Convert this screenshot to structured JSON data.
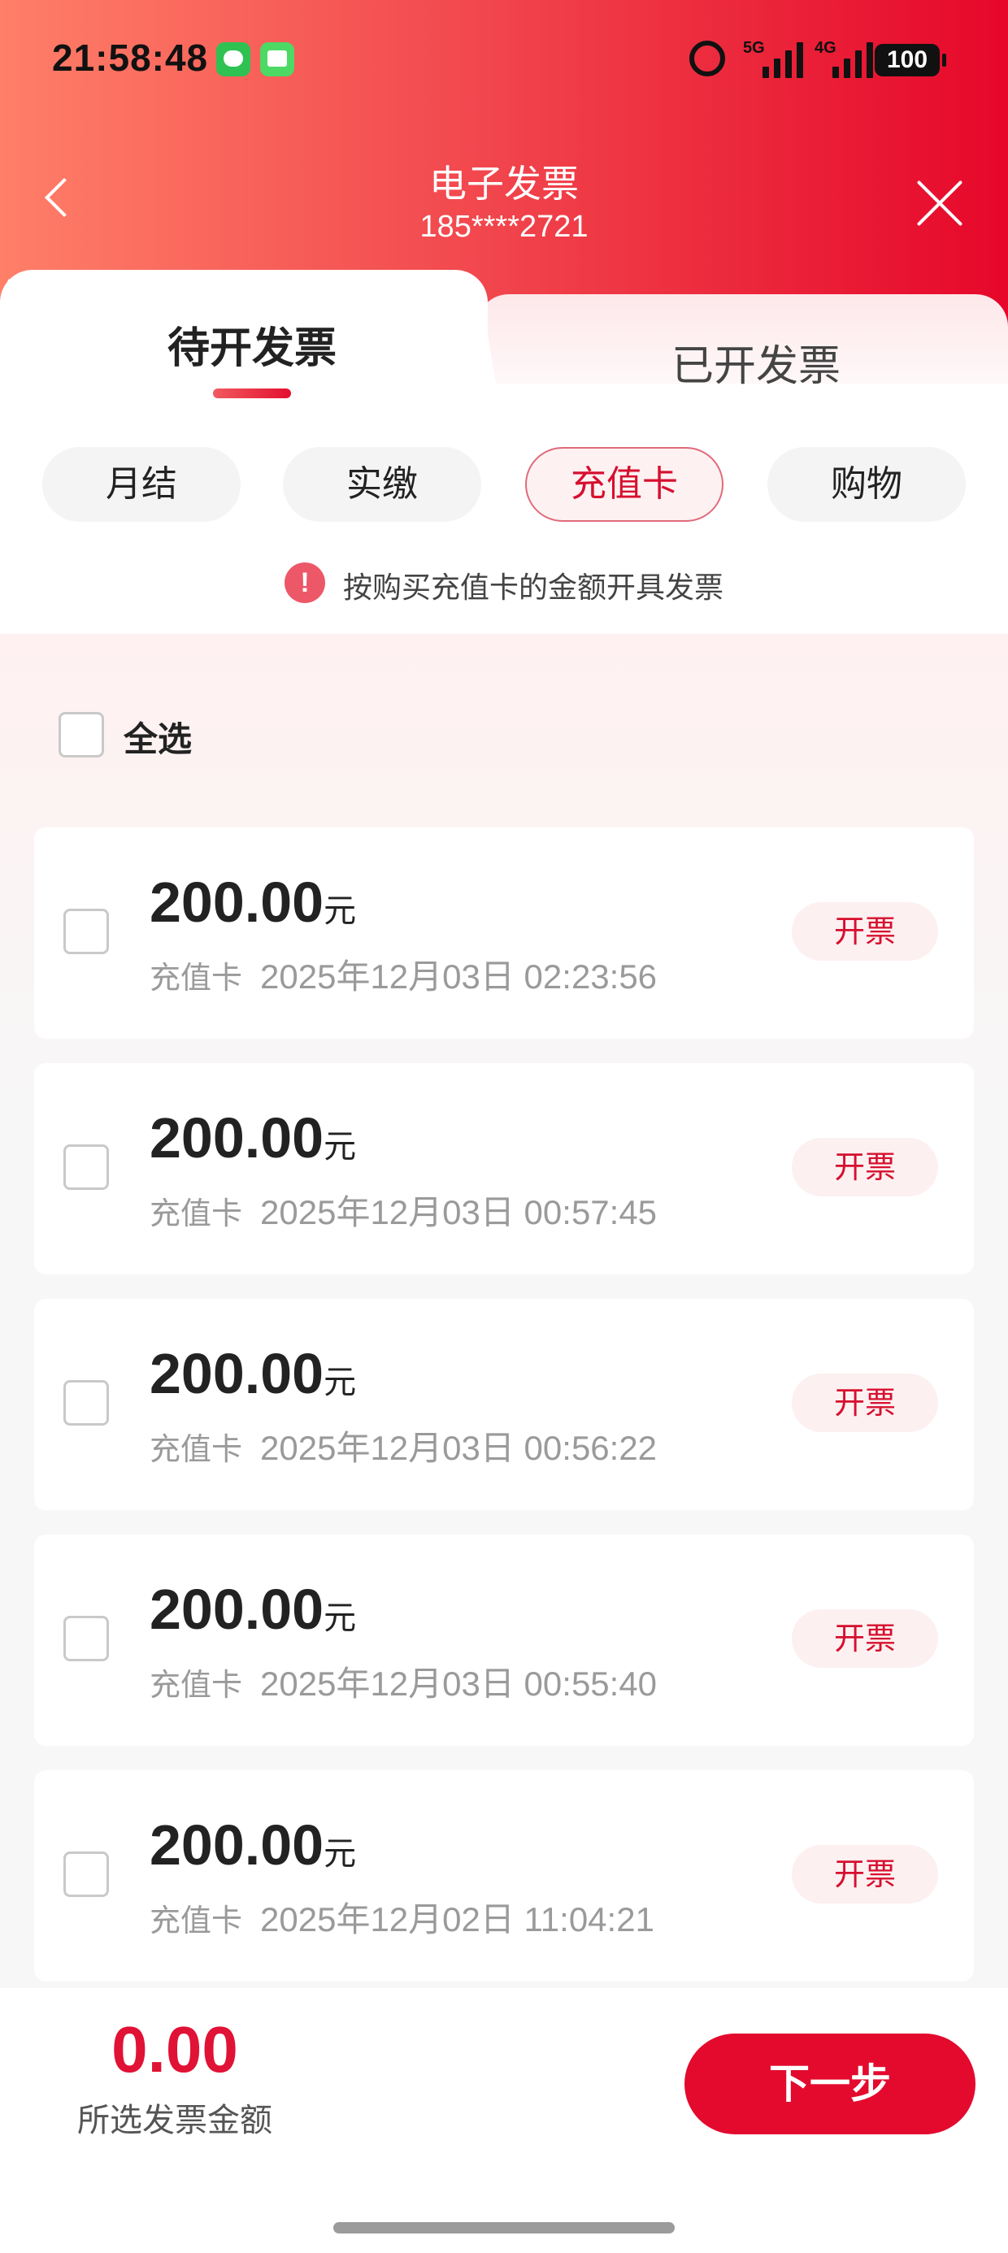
{
  "status_bar": {
    "time": "21:58:48",
    "net_5g": "5G",
    "net_4g": "4G",
    "battery": "100"
  },
  "header": {
    "title": "电子发票",
    "subtitle": "185****2721"
  },
  "tabs": {
    "pending": "待开发票",
    "issued": "已开发票"
  },
  "filters": {
    "monthly": "月结",
    "payment": "实缴",
    "recharge_card": "充值卡",
    "shopping": "购物"
  },
  "notice": {
    "icon": "!",
    "text": "按购买充值卡的金额开具发票"
  },
  "select_all": "全选",
  "records": [
    {
      "amount": "200.00",
      "unit": "元",
      "type": "充值卡",
      "time": "2025年12月03日 02:23:56",
      "action": "开票"
    },
    {
      "amount": "200.00",
      "unit": "元",
      "type": "充值卡",
      "time": "2025年12月03日 00:57:45",
      "action": "开票"
    },
    {
      "amount": "200.00",
      "unit": "元",
      "type": "充值卡",
      "time": "2025年12月03日 00:56:22",
      "action": "开票"
    },
    {
      "amount": "200.00",
      "unit": "元",
      "type": "充值卡",
      "time": "2025年12月03日 00:55:40",
      "action": "开票"
    },
    {
      "amount": "200.00",
      "unit": "元",
      "type": "充值卡",
      "time": "2025年12月02日 11:04:21",
      "action": "开票"
    }
  ],
  "footer": {
    "total_amount": "0.00",
    "total_label": "所选发票金额",
    "next_button": "下一步"
  },
  "colors": {
    "accent": "#e30a2e",
    "header_start": "#ff7f68",
    "header_end": "#e6072a"
  }
}
